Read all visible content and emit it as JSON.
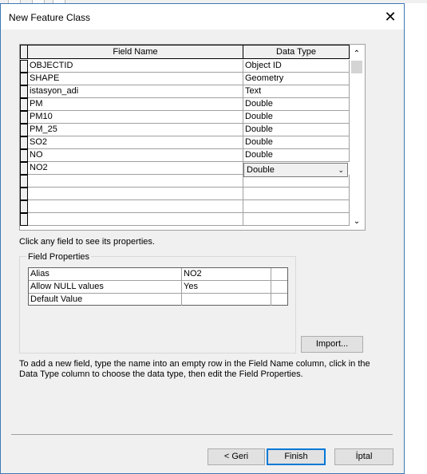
{
  "window": {
    "title": "New Feature Class",
    "close_glyph": "✕"
  },
  "grid": {
    "columns": [
      "Field Name",
      "Data Type"
    ],
    "rows": [
      {
        "name": "OBJECTID",
        "type": "Object ID"
      },
      {
        "name": "SHAPE",
        "type": "Geometry"
      },
      {
        "name": "istasyon_adi",
        "type": "Text"
      },
      {
        "name": "PM",
        "type": "Double"
      },
      {
        "name": "PM10",
        "type": "Double"
      },
      {
        "name": "PM_25",
        "type": "Double"
      },
      {
        "name": "SO2",
        "type": "Double"
      },
      {
        "name": "NO",
        "type": "Double"
      },
      {
        "name": "NO2",
        "type": "Double"
      }
    ],
    "selected_type": "Double",
    "scroll_up": "⌃",
    "scroll_down": "⌄",
    "dropdown_arrow": "⌄"
  },
  "hint": "Click any field to see its properties.",
  "field_properties": {
    "label": "Field Properties",
    "rows": [
      {
        "name": "Alias",
        "value": "NO2"
      },
      {
        "name": "Allow NULL values",
        "value": "Yes"
      },
      {
        "name": "Default Value",
        "value": ""
      }
    ]
  },
  "buttons": {
    "import": "Import...",
    "back": "< Geri",
    "finish": "Finish",
    "cancel": "İptal"
  },
  "description": "To add a new field, type the name into an empty row in the Field Name column, click in the Data Type column to choose the data type, then edit the Field Properties.",
  "colors": {
    "accent": "#0078d7",
    "window_border": "#3c78b4",
    "dialog_bg": "#f0f0f0"
  }
}
